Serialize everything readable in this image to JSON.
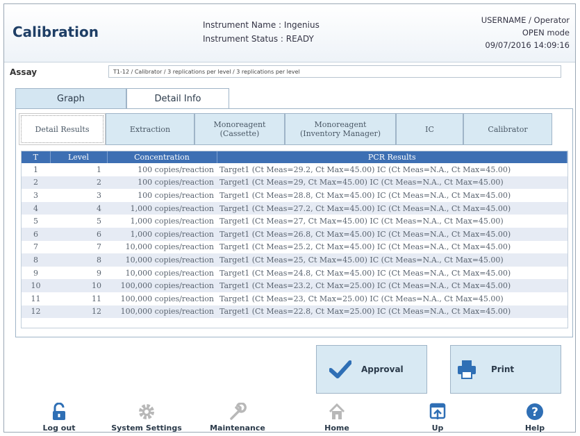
{
  "header": {
    "title": "Calibration",
    "instrument_name": "Instrument Name : Ingenius",
    "instrument_status": "Instrument Status : READY",
    "user": "USERNAME / Operator",
    "mode": "OPEN mode",
    "datetime": "09/07/2016 14:09:16"
  },
  "assay": {
    "label": "Assay",
    "value": "T1-12 / Calibrator / 3 replications per level / 3 replications per level"
  },
  "tabs": [
    {
      "label": "Graph"
    },
    {
      "label": "Detail Info"
    }
  ],
  "subtabs": [
    {
      "label": "Detail Results"
    },
    {
      "label": "Extraction"
    },
    {
      "label": "Monoreagent (Cassette)"
    },
    {
      "label": "Monoreagent (Inventory Manager)"
    },
    {
      "label": "IC"
    },
    {
      "label": "Calibrator"
    }
  ],
  "table": {
    "headers": [
      "T",
      "Level",
      "Concentration",
      "PCR Results"
    ],
    "rows": [
      [
        "1",
        "1",
        "100 copies/reaction",
        "Target1 (Ct Meas=29.2, Ct Max=45.00) IC (Ct Meas=N.A., Ct Max=45.00)"
      ],
      [
        "2",
        "2",
        "100 copies/reaction",
        "Target1 (Ct Meas=29, Ct Max=45.00) IC (Ct Meas=N.A., Ct Max=45.00)"
      ],
      [
        "3",
        "3",
        "100 copies/reaction",
        "Target1 (Ct Meas=28.8, Ct Max=45.00) IC (Ct Meas=N.A., Ct Max=45.00)"
      ],
      [
        "4",
        "4",
        "1,000 copies/reaction",
        "Target1 (Ct Meas=27.2, Ct Max=45.00) IC (Ct Meas=N.A., Ct Max=45.00)"
      ],
      [
        "5",
        "5",
        "1,000 copies/reaction",
        "Target1 (Ct Meas=27, Ct Max=45.00) IC (Ct Meas=N.A., Ct Max=45.00)"
      ],
      [
        "6",
        "6",
        "1,000 copies/reaction",
        "Target1 (Ct Meas=26.8, Ct Max=45.00) IC (Ct Meas=N.A., Ct Max=45.00)"
      ],
      [
        "7",
        "7",
        "10,000 copies/reaction",
        "Target1 (Ct Meas=25.2, Ct Max=45.00) IC (Ct Meas=N.A., Ct Max=45.00)"
      ],
      [
        "8",
        "8",
        "10,000 copies/reaction",
        "Target1 (Ct Meas=25, Ct Max=45.00) IC (Ct Meas=N.A., Ct Max=45.00)"
      ],
      [
        "9",
        "9",
        "10,000 copies/reaction",
        "Target1 (Ct Meas=24.8, Ct Max=45.00) IC (Ct Meas=N.A., Ct Max=45.00)"
      ],
      [
        "10",
        "10",
        "100,000 copies/reaction",
        "Target1 (Ct Meas=23.2, Ct Max=25.00) IC (Ct Meas=N.A., Ct Max=45.00)"
      ],
      [
        "11",
        "11",
        "100,000 copies/reaction",
        "Target1 (Ct Meas=23, Ct Max=25.00) IC (Ct Meas=N.A., Ct Max=45.00)"
      ],
      [
        "12",
        "12",
        "100,000 copies/reaction",
        "Target1 (Ct Meas=22.8, Ct Max=25.00) IC (Ct Meas=N.A., Ct Max=45.00)"
      ]
    ]
  },
  "actions": {
    "approval": "Approval",
    "print": "Print"
  },
  "nav": {
    "logout": "Log out",
    "system_settings": "System Settings",
    "maintenance": "Maintenance",
    "home": "Home",
    "up": "Up",
    "help": "Help"
  },
  "colors": {
    "title": "#1f3f66",
    "table_header": "#3d6fb3",
    "tab_inactive": "#d4e6f2",
    "row_alt": "#e6ebf4",
    "icon_blue": "#2f6fb5",
    "icon_gray": "#b8b8b8"
  },
  "icons": {
    "approval": "checkmark-icon",
    "print": "printer-icon",
    "logout": "unlock-icon",
    "system_settings": "gear-icon",
    "maintenance": "wrench-icon",
    "home": "home-icon",
    "up": "up-arrow-icon",
    "help": "question-icon"
  }
}
